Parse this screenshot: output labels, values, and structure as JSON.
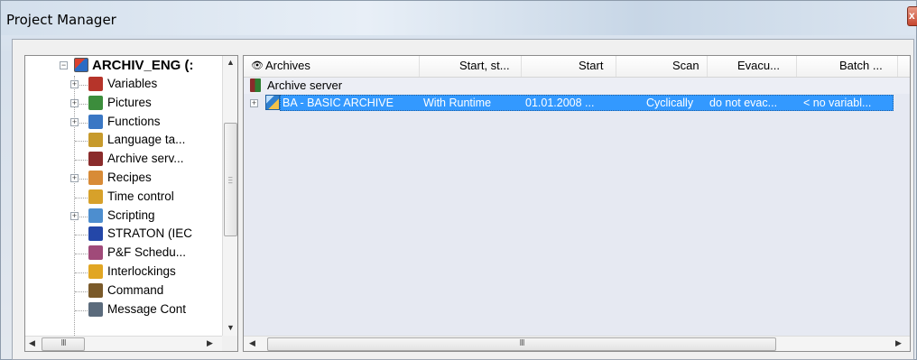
{
  "window": {
    "title": "Project Manager",
    "close_glyph": "x"
  },
  "tree": {
    "root": {
      "label": "ARCHIV_ENG (:"
    },
    "items": [
      {
        "label": "Variables",
        "icon": "variables-icon",
        "color": "#b6342a",
        "expand": true
      },
      {
        "label": "Pictures",
        "icon": "pictures-icon",
        "color": "#3c8d3c",
        "expand": true
      },
      {
        "label": "Functions",
        "icon": "functions-icon",
        "color": "#3a77c4",
        "expand": true
      },
      {
        "label": "Language ta...",
        "icon": "language-table-icon",
        "color": "#c79a2c",
        "expand": false
      },
      {
        "label": "Archive serv...",
        "icon": "archive-server-icon",
        "color": "#8a2b2b",
        "expand": false
      },
      {
        "label": "Recipes",
        "icon": "recipes-icon",
        "color": "#d88b37",
        "expand": true
      },
      {
        "label": "Time control",
        "icon": "time-control-icon",
        "color": "#d7a12a",
        "expand": false
      },
      {
        "label": "Scripting",
        "icon": "scripting-icon",
        "color": "#4d8ecf",
        "expand": true
      },
      {
        "label": "STRATON (IEC",
        "icon": "straton-icon",
        "color": "#2447a8",
        "expand": false
      },
      {
        "label": "P&F Schedu...",
        "icon": "pf-scheduler-icon",
        "color": "#a04a79",
        "expand": false
      },
      {
        "label": "Interlockings",
        "icon": "interlockings-icon",
        "color": "#e1a623",
        "expand": false
      },
      {
        "label": "Command",
        "icon": "command-icon",
        "color": "#7a5a2a",
        "expand": false
      },
      {
        "label": "Message Cont",
        "icon": "message-control-icon",
        "color": "#5b6b7c",
        "expand": false
      }
    ],
    "hscroll_grip": "III"
  },
  "list": {
    "columns": [
      {
        "label": "Archives",
        "icon": "binoculars-icon"
      },
      {
        "label": "Start, st..."
      },
      {
        "label": "Start"
      },
      {
        "label": "Scan"
      },
      {
        "label": "Evacu..."
      },
      {
        "label": "Batch ..."
      }
    ],
    "group": {
      "label": "Archive server",
      "icon": "archive-server-icon"
    },
    "rows": [
      {
        "archive": "BA - BASIC ARCHIVE",
        "start_type": "With Runtime",
        "start": "01.01.2008 ...",
        "scan": "Cyclically",
        "evacuation": "do not evac...",
        "batch": "< no variabl..."
      }
    ],
    "hscroll_grip": "III"
  },
  "colors": {
    "selection": "#3399ff",
    "list_bg": "#e6e9f2"
  }
}
